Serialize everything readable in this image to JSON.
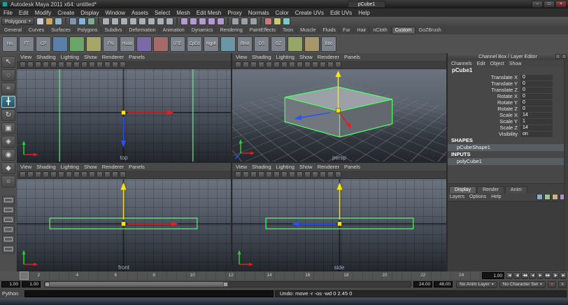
{
  "colors": {
    "selection_green": "#4dff66",
    "manip_red": "#e02020",
    "manip_yellow": "#ffe600",
    "manip_blue": "#2a50ff",
    "axis_green": "#30cc40",
    "viewport_top": "#6a737e",
    "viewport_bottom": "#23262c",
    "app_logo": "#1f9e9e"
  },
  "icons": {
    "dropdown_arrow": "▾",
    "autokey_dot": "●",
    "preferences_glyph": "≡"
  },
  "window": {
    "title": "Autodesk Maya 2011 x64: untitled*",
    "selection_field": "pCube1",
    "controls": {
      "minimize": "–",
      "maximize": "□",
      "close": "×"
    }
  },
  "menu_bar": {
    "items": [
      "File",
      "Edit",
      "Modify",
      "Create",
      "Display",
      "Window",
      "Assets",
      "Select",
      "Mesh",
      "Edit Mesh",
      "Proxy",
      "Normals",
      "Color",
      "Create UVs",
      "Edit UVs",
      "Help"
    ]
  },
  "status_line": {
    "mode": "Polygons",
    "icons": [
      {
        "name": "new-scene-icon",
        "color": "#c9cdd1"
      },
      {
        "name": "open-scene-icon",
        "color": "#c9a96a"
      },
      {
        "name": "save-scene-icon",
        "color": "#8fb4c9"
      },
      {
        "name": "separator"
      },
      {
        "name": "select-hierarchy-icon",
        "color": "#7f95ab"
      },
      {
        "name": "select-object-icon",
        "color": "#86b3d9"
      },
      {
        "name": "select-component-icon",
        "color": "#7fab95"
      },
      {
        "name": "separator"
      },
      {
        "name": "mask-points-icon",
        "color": "#a9b0b6"
      },
      {
        "name": "mask-handles-icon",
        "color": "#a9b0b6"
      },
      {
        "name": "mask-lines-icon",
        "color": "#a9b0b6"
      },
      {
        "name": "mask-surfaces-icon",
        "color": "#a9b0b6"
      },
      {
        "name": "mask-deformations-icon",
        "color": "#a9b0b6"
      },
      {
        "name": "mask-dynamics-icon",
        "color": "#a9b0b6"
      },
      {
        "name": "mask-rendering-icon",
        "color": "#a9b0b6"
      },
      {
        "name": "mask-misc-icon",
        "color": "#a9b0b6"
      },
      {
        "name": "separator"
      },
      {
        "name": "snap-grid-icon",
        "color": "#b49ad1"
      },
      {
        "name": "snap-curve-icon",
        "color": "#b49ad1"
      },
      {
        "name": "snap-point-icon",
        "color": "#b49ad1"
      },
      {
        "name": "snap-view-plane-icon",
        "color": "#b49ad1"
      },
      {
        "name": "make-live-icon",
        "color": "#b49ad1"
      },
      {
        "name": "separator"
      },
      {
        "name": "input-connections-icon",
        "color": "#9aa0a6"
      },
      {
        "name": "output-connections-icon",
        "color": "#9aa0a6"
      },
      {
        "name": "construction-history-icon",
        "color": "#9aa0a6"
      },
      {
        "name": "separator"
      },
      {
        "name": "render-current-frame-icon",
        "color": "#c97a7a"
      },
      {
        "name": "ipr-render-icon",
        "color": "#c9c97a"
      },
      {
        "name": "render-settings-icon",
        "color": "#7ac9c9"
      }
    ]
  },
  "shelf": {
    "tabs": [
      {
        "label": "General"
      },
      {
        "label": "Curves"
      },
      {
        "label": "Surfaces"
      },
      {
        "label": "Polygons"
      },
      {
        "label": "Subdivs"
      },
      {
        "label": "Deformation"
      },
      {
        "label": "Animation"
      },
      {
        "label": "Dynamics"
      },
      {
        "label": "Rendering"
      },
      {
        "label": "PaintEffects"
      },
      {
        "label": "Toon"
      },
      {
        "label": "Muscle"
      },
      {
        "label": "Fluids"
      },
      {
        "label": "Fur"
      },
      {
        "label": "Hair"
      },
      {
        "label": "nCloth"
      },
      {
        "label": "Custom",
        "active": true
      },
      {
        "label": "GoZBrush"
      }
    ],
    "items": [
      {
        "name": "shelf-his-button",
        "label": "His",
        "color": "#7d838a"
      },
      {
        "name": "shelf-ft-button",
        "label": "FT",
        "color": "#7d838a"
      },
      {
        "name": "shelf-cp-button",
        "label": "CP",
        "color": "#7d838a"
      },
      {
        "name": "shelf-item",
        "label": "",
        "color": "#5b7fa6"
      },
      {
        "name": "shelf-item",
        "label": "",
        "color": "#6aa66a"
      },
      {
        "name": "shelf-item",
        "label": "",
        "color": "#a6a66a"
      },
      {
        "name": "shelf-fn-button",
        "label": "FN",
        "color": "#7d838a"
      },
      {
        "name": "shelf-hsbd-button",
        "label": "Hsbd",
        "color": "#7d838a"
      },
      {
        "name": "shelf-item",
        "label": "",
        "color": "#7a6aa6"
      },
      {
        "name": "shelf-item",
        "label": "",
        "color": "#a66a6a"
      },
      {
        "name": "shelf-ute-button",
        "label": "UTE",
        "color": "#7d838a"
      },
      {
        "name": "shelf-cped-button",
        "label": "CpEd",
        "color": "#7d838a"
      },
      {
        "name": "shelf-hgpk-button",
        "label": "HgpK",
        "color": "#7d838a"
      },
      {
        "name": "shelf-item",
        "label": "",
        "color": "#6a96a6"
      },
      {
        "name": "shelf-blnd-button",
        "label": "Blnd",
        "color": "#7d838a"
      },
      {
        "name": "shelf-ds-button",
        "label": "DS",
        "color": "#7d838a"
      },
      {
        "name": "shelf-gz-button",
        "label": "GZ",
        "color": "#7d838a"
      },
      {
        "name": "shelf-item",
        "label": "",
        "color": "#96a66a"
      },
      {
        "name": "shelf-item",
        "label": "",
        "color": "#a6966a"
      },
      {
        "name": "shelf-bbo-button",
        "label": "Bbo",
        "color": "#7d838a"
      }
    ]
  },
  "toolbox": {
    "tools": [
      {
        "name": "select-tool",
        "glyph": "↖"
      },
      {
        "name": "lasso-select-tool",
        "glyph": "◌"
      },
      {
        "name": "paint-select-tool",
        "glyph": "≈"
      },
      {
        "name": "move-tool",
        "glyph": "╋",
        "active": true
      },
      {
        "name": "rotate-tool",
        "glyph": "↻"
      },
      {
        "name": "scale-tool",
        "glyph": "▣"
      },
      {
        "name": "universal-manipulator-tool",
        "glyph": "◈"
      },
      {
        "name": "soft-modification-tool",
        "glyph": "◉"
      },
      {
        "name": "show-manipulator-tool",
        "glyph": "◆"
      },
      {
        "name": "last-tool",
        "glyph": "○"
      }
    ],
    "layout_buttons": [
      {
        "name": "single-pane-layout-button"
      },
      {
        "name": "four-pane-layout-button"
      },
      {
        "name": "persp-outliner-layout-button"
      },
      {
        "name": "persp-graph-layout-button"
      },
      {
        "name": "hypershade-persp-layout-button"
      },
      {
        "name": "persp-uv-layout-button"
      }
    ]
  },
  "viewports": {
    "menu_items": [
      "View",
      "Shading",
      "Lighting",
      "Show",
      "Renderer",
      "Panels"
    ],
    "toolbar_icons": [
      {
        "name": "select-camera-icon"
      },
      {
        "name": "lock-camera-icon"
      },
      {
        "name": "camera-attributes-icon"
      },
      {
        "name": "bookmark-icon"
      },
      {
        "name": "image-plane-icon"
      },
      {
        "name": "2d-pan-zoom-icon"
      },
      {
        "name": "grease-pencil-icon"
      },
      {
        "name": "grid-icon"
      },
      {
        "name": "film-gate-icon"
      },
      {
        "name": "resolution-gate-icon"
      },
      {
        "name": "gate-mask-icon"
      },
      {
        "name": "field-chart-icon"
      },
      {
        "name": "safe-action-icon"
      },
      {
        "name": "safe-title-icon"
      }
    ],
    "panes": [
      {
        "label": "top"
      },
      {
        "label": "persp"
      },
      {
        "label": "front"
      },
      {
        "label": "side"
      }
    ]
  },
  "channel_box": {
    "header": "Channel Box / Layer Editor",
    "menus": [
      "Channels",
      "Edit",
      "Object",
      "Show"
    ],
    "object_name": "pCube1",
    "attributes": [
      {
        "label": "Translate X",
        "value": "0"
      },
      {
        "label": "Translate Y",
        "value": "0"
      },
      {
        "label": "Translate Z",
        "value": "0"
      },
      {
        "label": "Rotate X",
        "value": "0"
      },
      {
        "label": "Rotate Y",
        "value": "0"
      },
      {
        "label": "Rotate Z",
        "value": "0"
      },
      {
        "label": "Scale X",
        "value": "14"
      },
      {
        "label": "Scale Y",
        "value": "1"
      },
      {
        "label": "Scale Z",
        "value": "14"
      },
      {
        "label": "Visibility",
        "value": "on"
      }
    ],
    "shapes_header": "SHAPES",
    "shape_name": "pCubeShape1",
    "inputs_header": "INPUTS",
    "input_name": "polyCube1"
  },
  "layer_editor": {
    "tabs": [
      {
        "label": "Display",
        "active": true
      },
      {
        "label": "Render"
      },
      {
        "label": "Anim"
      }
    ],
    "menus": [
      "Layers",
      "Options",
      "Help"
    ],
    "icons": [
      {
        "name": "create-empty-layer-icon",
        "color": "#8fa9c4"
      },
      {
        "name": "create-layer-from-selected-icon",
        "color": "#9ec48f"
      },
      {
        "name": "move-layer-up-icon",
        "color": "#c4b48f"
      },
      {
        "name": "move-layer-down-icon",
        "color": "#b08fc4"
      }
    ]
  },
  "time_slider": {
    "tick_labels": [
      "2",
      "4",
      "6",
      "8",
      "10",
      "12",
      "14",
      "16",
      "18",
      "20",
      "22",
      "24"
    ],
    "current_frame": "1.00",
    "playback_buttons": [
      {
        "name": "go-to-start-button",
        "glyph": "|◀"
      },
      {
        "name": "step-back-frame-button",
        "glyph": "◀|"
      },
      {
        "name": "step-back-key-button",
        "glyph": "◀◀"
      },
      {
        "name": "play-backwards-button",
        "glyph": "◀"
      },
      {
        "name": "play-forwards-button",
        "glyph": "▶"
      },
      {
        "name": "step-forward-key-button",
        "glyph": "▶▶"
      },
      {
        "name": "step-forward-frame-button",
        "glyph": "|▶"
      },
      {
        "name": "go-to-end-button",
        "glyph": "▶|"
      }
    ]
  },
  "range_slider": {
    "anim_start": "1.00",
    "playback_start": "1.00",
    "playback_end": "24.00",
    "anim_end": "48.00",
    "anim_layer": "No Anim Layer",
    "character_set": "No Character Set"
  },
  "command_line": {
    "language": "Python",
    "input_value": "",
    "result": "Undo: move -r -os -wd 0 2.45 0"
  }
}
